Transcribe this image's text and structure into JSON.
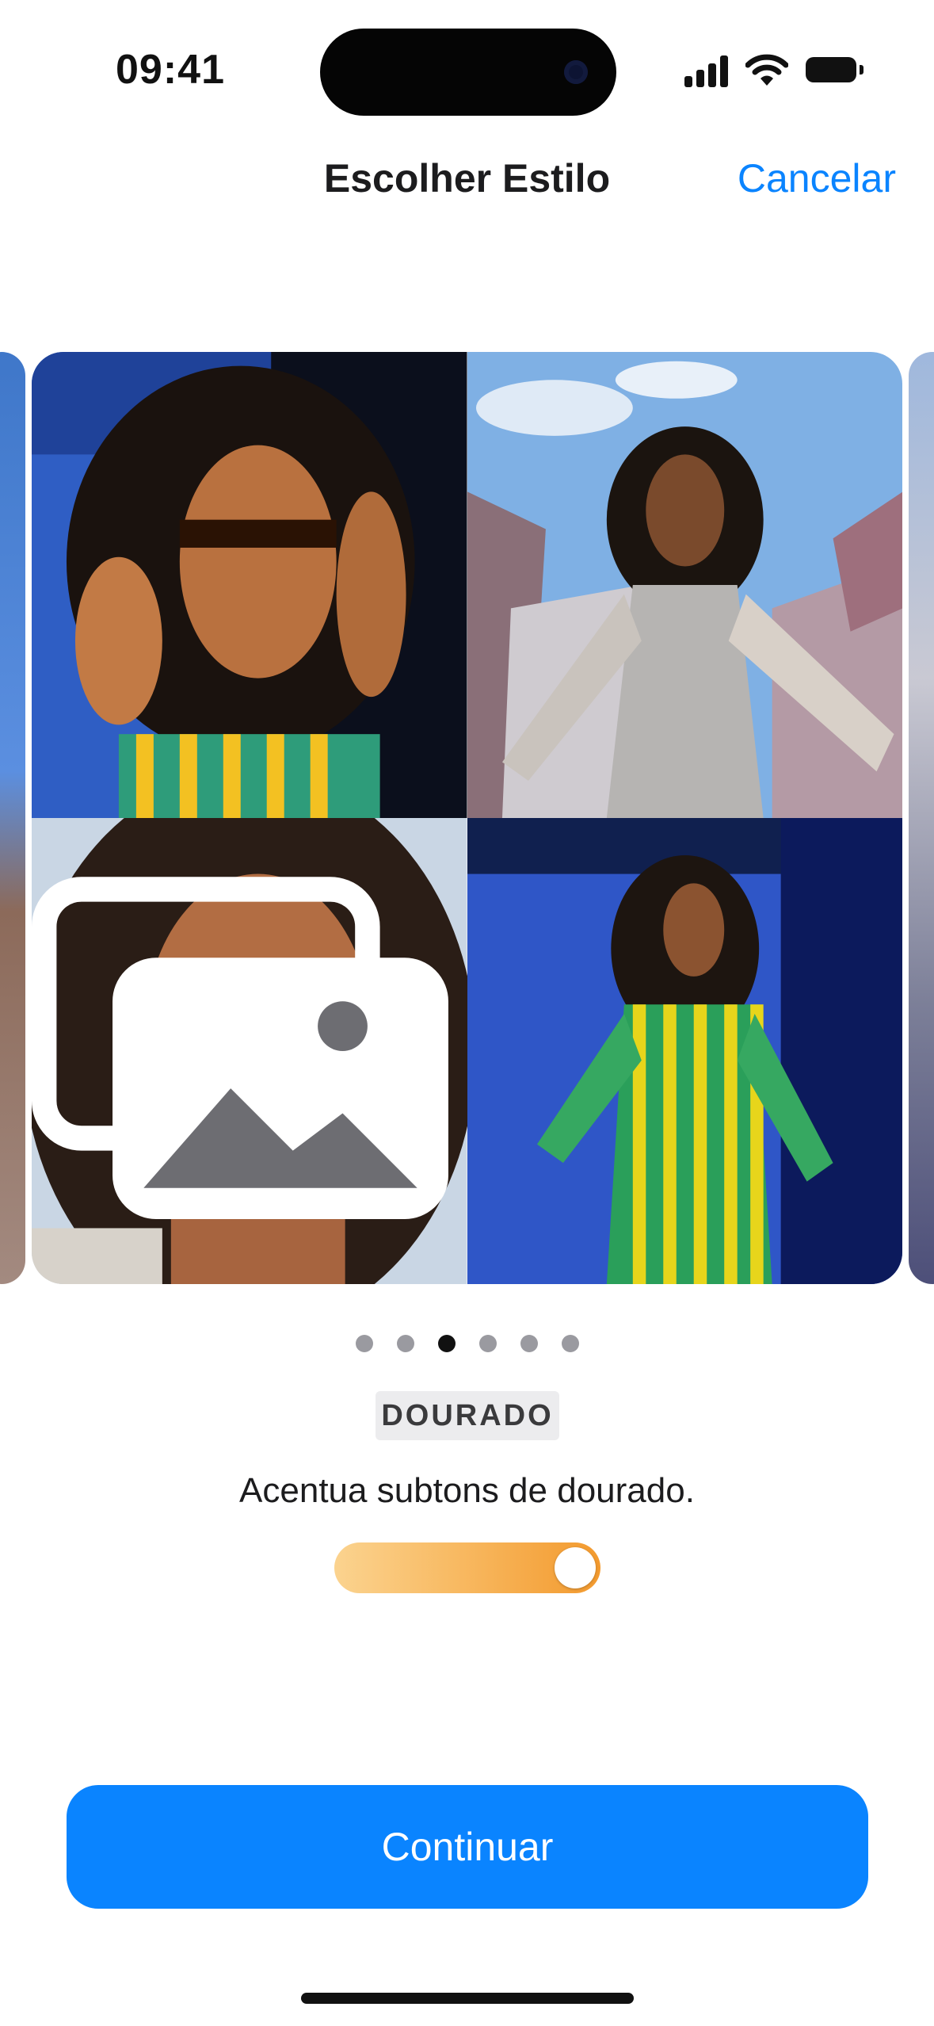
{
  "status_bar": {
    "time": "09:41",
    "icons": [
      "cellular-signal-icon",
      "wifi-icon",
      "battery-icon"
    ]
  },
  "nav": {
    "title": "Escolher Estilo",
    "cancel_label": "Cancelar"
  },
  "carousel": {
    "photos": [
      {
        "desc": "portrait-sunglasses"
      },
      {
        "desc": "portrait-sky"
      },
      {
        "desc": "portrait-closeup"
      },
      {
        "desc": "portrait-striped-dress"
      }
    ],
    "gallery_icon": "photo-library-icon",
    "page_count": 6,
    "active_page": 3
  },
  "style": {
    "name": "DOURADO",
    "description": "Acentua subtons de dourado.",
    "intensity": 1.0,
    "gradient_colors": [
      "#fbd38f",
      "#f39a2e"
    ]
  },
  "actions": {
    "continue_label": "Continuar"
  },
  "colors": {
    "accent": "#0a84ff"
  }
}
